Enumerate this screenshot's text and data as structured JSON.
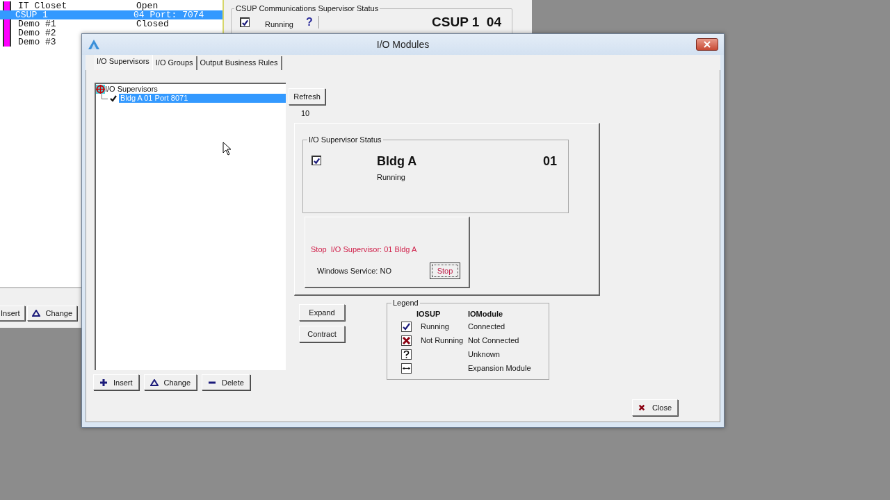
{
  "background_window": {
    "list_rows": [
      {
        "name": "IT Closet",
        "status": "Open",
        "selected": false,
        "color": "#ff00ff"
      },
      {
        "name": "CSUP 1",
        "status": "04 Port: 7074",
        "selected": true
      },
      {
        "name": "Demo #1",
        "status": "Closed",
        "selected": false,
        "color": "#ff00ff"
      },
      {
        "name": "Demo #2",
        "selected": false,
        "color": "#ff00ff"
      },
      {
        "name": "Demo #3",
        "selected": false,
        "color": "#ff00ff"
      }
    ],
    "buttons": [
      {
        "label": "Insert",
        "kind": "insert"
      },
      {
        "label": "Change",
        "kind": "change"
      }
    ],
    "status_panel": {
      "title": "CSUP Communications Supervisor Status",
      "checked": true,
      "state": "Running",
      "help": "?",
      "name": "CSUP 1  04"
    }
  },
  "dialog": {
    "title": "I/O Modules",
    "tabs": [
      {
        "label": "I/O Supervisors",
        "selected": true
      },
      {
        "label": "I/O Groups",
        "selected": false
      },
      {
        "label": "Output Business Rules",
        "selected": false
      }
    ],
    "tree": {
      "label": "I/O Supervisors",
      "children": [
        {
          "label": "Bldg A 01 Port 8071",
          "checked": true,
          "selected": true
        }
      ]
    },
    "tree_buttons": [
      {
        "label": "Insert",
        "kind": "insert"
      },
      {
        "label": "Change",
        "kind": "change"
      },
      {
        "label": "Delete",
        "kind": "delete"
      }
    ],
    "refresh_button": "Refresh",
    "count": "10",
    "status": {
      "title": "I/O Supervisor Status",
      "checked": true,
      "name": "Bldg A",
      "number": "01",
      "state": "Running"
    },
    "service": {
      "message": "Stop  I/O Supervisor: 01 Bldg A",
      "windows_service": "Windows Service: NO",
      "button": "Stop"
    },
    "side_buttons": [
      "Expand",
      "Contract"
    ],
    "legend": {
      "title": "Legend",
      "columns": [
        "IOSUP",
        "IOModule"
      ],
      "rows": [
        {
          "kind": "check",
          "iosup": "Running",
          "iomodule": "Connected"
        },
        {
          "kind": "cross",
          "iosup": "Not Running",
          "iomodule": "Not Connected"
        },
        {
          "kind": "unknown",
          "iomodule": "Unknown"
        },
        {
          "kind": "expansion",
          "iomodule": "Expansion Module"
        }
      ]
    },
    "close_button": "Close"
  }
}
